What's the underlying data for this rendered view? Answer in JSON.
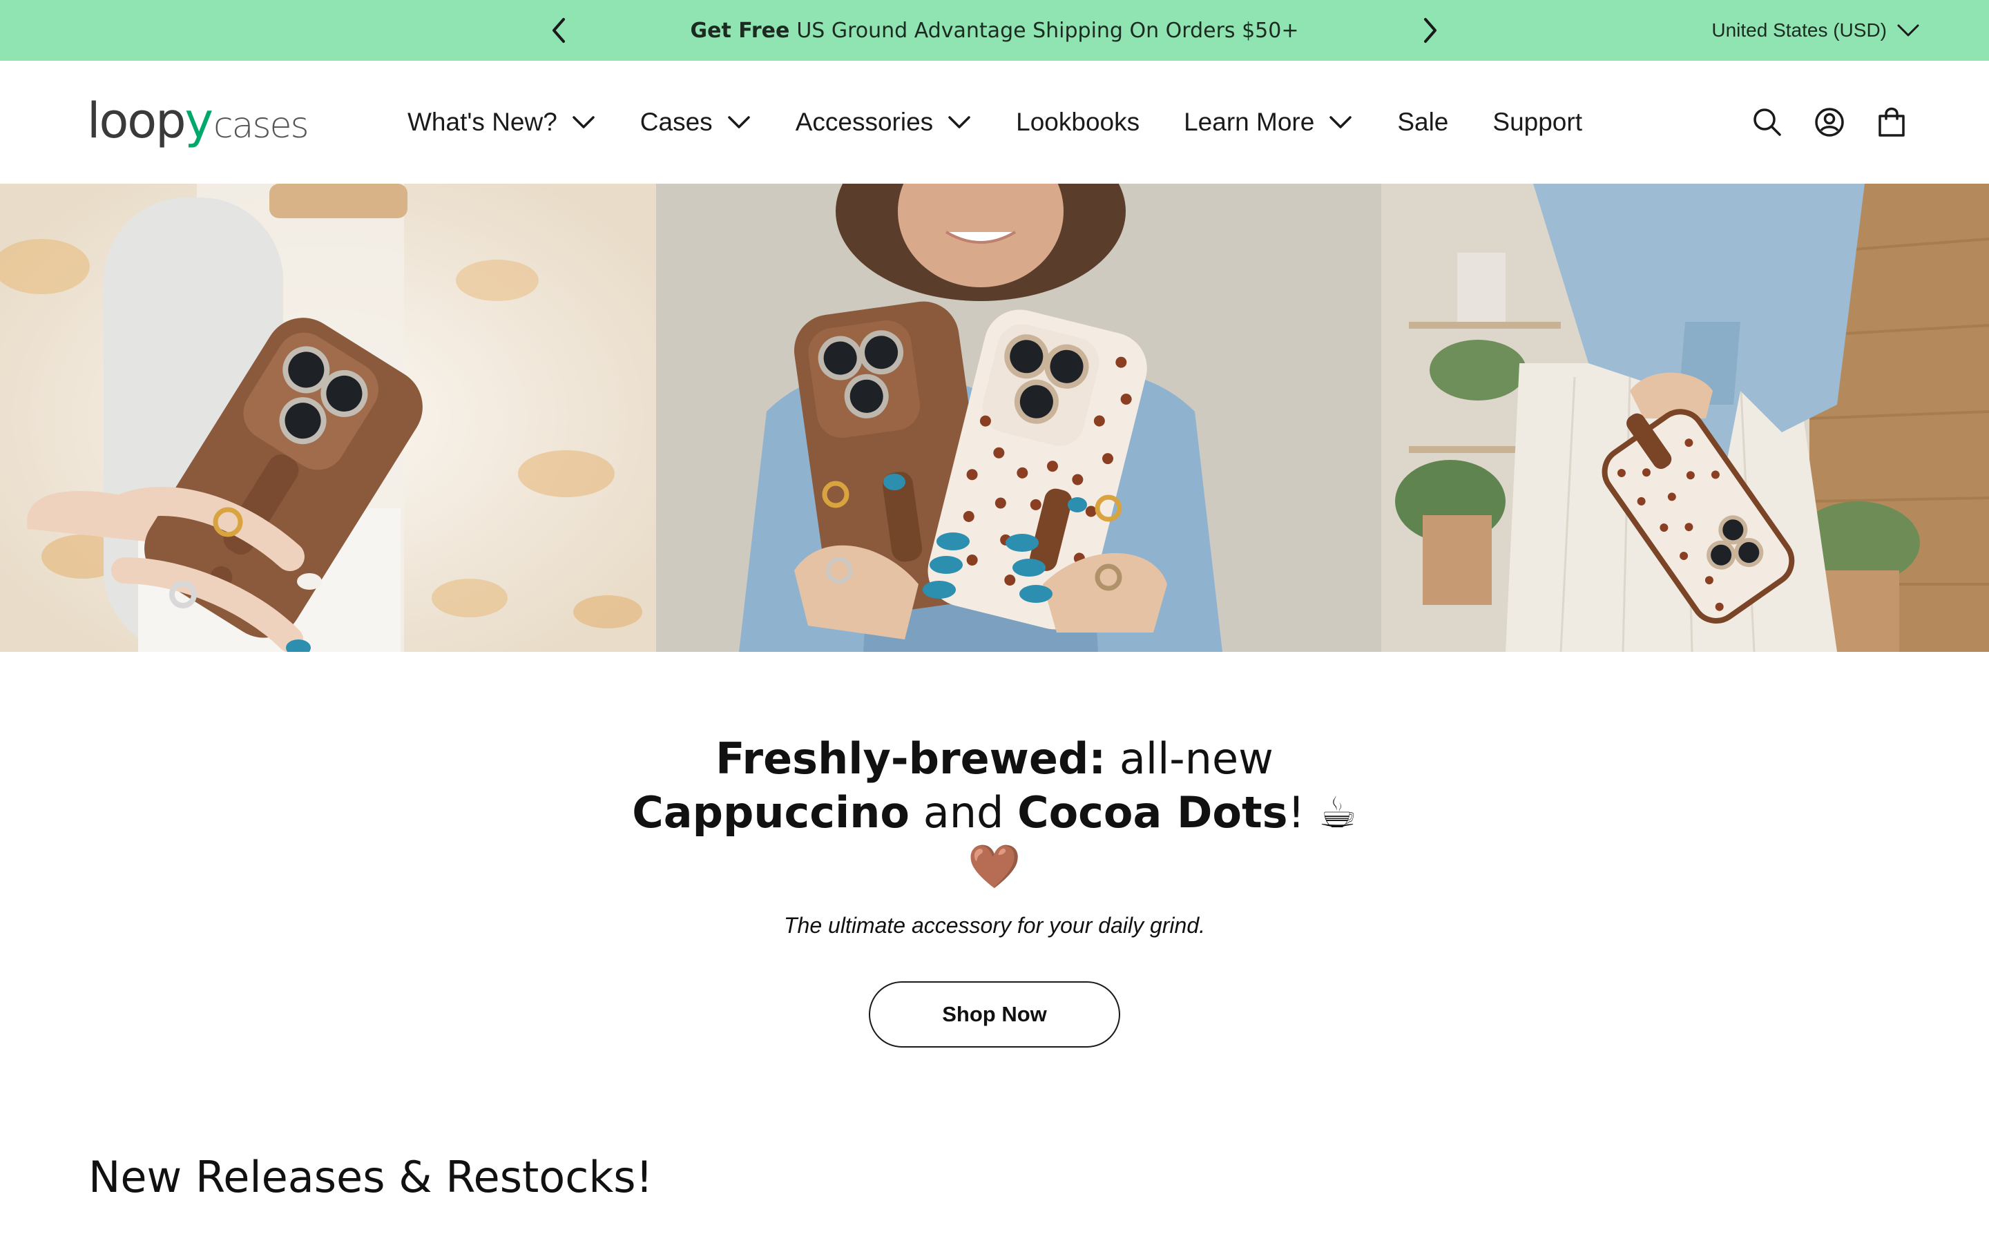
{
  "announcement": {
    "bold": "Get Free",
    "text": "US Ground Advantage Shipping On Orders $50+",
    "currency": "United States (USD)"
  },
  "header": {
    "logo": {
      "part1": "loop",
      "part2": "y",
      "part3": "cases"
    },
    "nav": [
      {
        "label": "What's New?",
        "dropdown": true
      },
      {
        "label": "Cases",
        "dropdown": true
      },
      {
        "label": "Accessories",
        "dropdown": true
      },
      {
        "label": "Lookbooks",
        "dropdown": false
      },
      {
        "label": "Learn More",
        "dropdown": true
      },
      {
        "label": "Sale",
        "dropdown": false
      },
      {
        "label": "Support",
        "dropdown": false
      }
    ],
    "icons": [
      "search-icon",
      "account-icon",
      "cart-icon"
    ]
  },
  "hero": {
    "panels": [
      "hand-holding-cappuccino-case",
      "two-cases-cappuccino-and-cocoa-dots",
      "hand-holding-cocoa-dots-case"
    ]
  },
  "promo": {
    "title_bold1": "Freshly-brewed:",
    "title_part1": " all-new ",
    "title_bold2": "Cappuccino",
    "title_part2": " and ",
    "title_bold3": "Cocoa Dots",
    "title_part3": "! ☕ 🤎",
    "subtitle": "The ultimate accessory for your daily grind.",
    "button": "Shop Now"
  },
  "section": {
    "title": "New Releases & Restocks!"
  },
  "colors": {
    "announcement_bg": "#90e4b1",
    "case_brown": "#8b5a3c",
    "accent_teal": "#2d8fb0"
  }
}
